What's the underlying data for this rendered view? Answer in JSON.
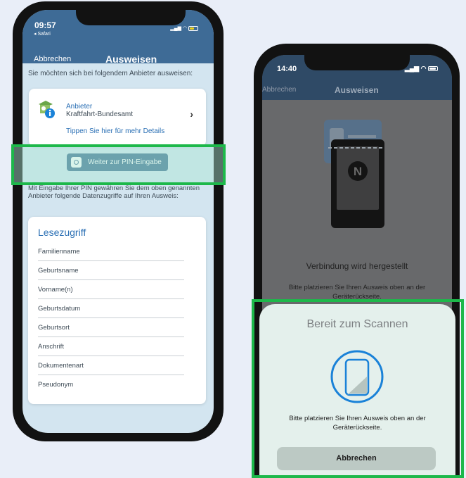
{
  "left_phone": {
    "status": {
      "time": "09:57",
      "back": "◂ Safari"
    },
    "nav": {
      "cancel": "Abbrechen",
      "title": "Ausweisen"
    },
    "question": "Sie möchten sich bei folgendem Anbieter ausweisen:",
    "provider": {
      "label": "Anbieter",
      "name": "Kraftfahrt-Bundesamt",
      "details_link": "Tippen Sie hier für mehr Details"
    },
    "pin_button": "Weiter zur PIN-Eingabe",
    "info_text": "Mit Eingabe Ihrer PIN gewähren Sie dem oben genannten Anbieter folgende Datenzugriffe auf Ihren Ausweis:",
    "read_access": {
      "title": "Lesezugriff",
      "items": [
        "Familienname",
        "Geburtsname",
        "Vorname(n)",
        "Geburtsdatum",
        "Geburtsort",
        "Anschrift",
        "Dokumentenart",
        "Pseudonym"
      ]
    }
  },
  "right_phone": {
    "status": {
      "time": "14:40"
    },
    "nav": {
      "cancel": "Abbrechen",
      "title": "Ausweisen"
    },
    "connecting": "Verbindung wird hergestellt",
    "place_card": "Bitte platzieren Sie Ihren Ausweis oben an der Geräterückseite.",
    "sheet": {
      "title": "Bereit zum Scannen",
      "text": "Bitte platzieren Sie Ihren Ausweis oben an der Geräterückseite.",
      "cancel": "Abbrechen"
    }
  },
  "colors": {
    "header_blue": "#3e6b96",
    "link_blue": "#2a6fb4",
    "highlight_green": "#1db84a",
    "nfc_blue": "#1a82d8"
  },
  "icons": [
    "info-icon",
    "chevron-right-icon",
    "pin-icon",
    "wifi-icon",
    "battery-icon",
    "nfc-icon",
    "phone-scan-icon"
  ]
}
